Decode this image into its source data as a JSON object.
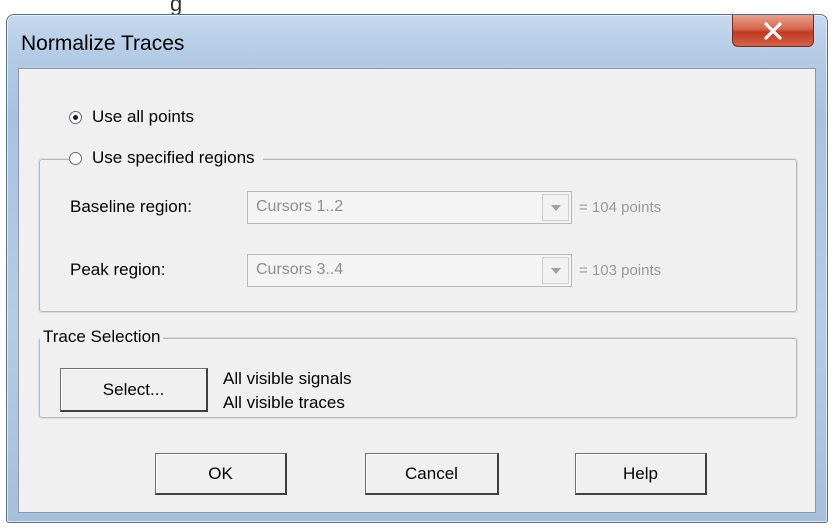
{
  "window": {
    "title": "Normalize Traces",
    "close_glyph": "✕"
  },
  "options": {
    "use_all_points": {
      "label": "Use all points",
      "checked": true
    },
    "use_specified_regions": {
      "label": "Use specified regions",
      "checked": false
    }
  },
  "regions": {
    "baseline": {
      "label": "Baseline region:",
      "value": "Cursors 1..2",
      "points": "= 104 points"
    },
    "peak": {
      "label": "Peak region:",
      "value": "Cursors 3..4",
      "points": "= 103 points"
    }
  },
  "trace_selection": {
    "title": "Trace Selection",
    "select_label": "Select...",
    "signals_text": "All visible signals",
    "traces_text": "All visible traces"
  },
  "buttons": {
    "ok": "OK",
    "cancel": "Cancel",
    "help": "Help"
  },
  "icons": {
    "close": "close-icon",
    "dropdown": "chevron-down-icon"
  },
  "colors": {
    "close_button": "#c13a22",
    "frame": "#b3cbe5",
    "client": "#f0f0f0",
    "disabled_text": "#8e8e8e"
  }
}
